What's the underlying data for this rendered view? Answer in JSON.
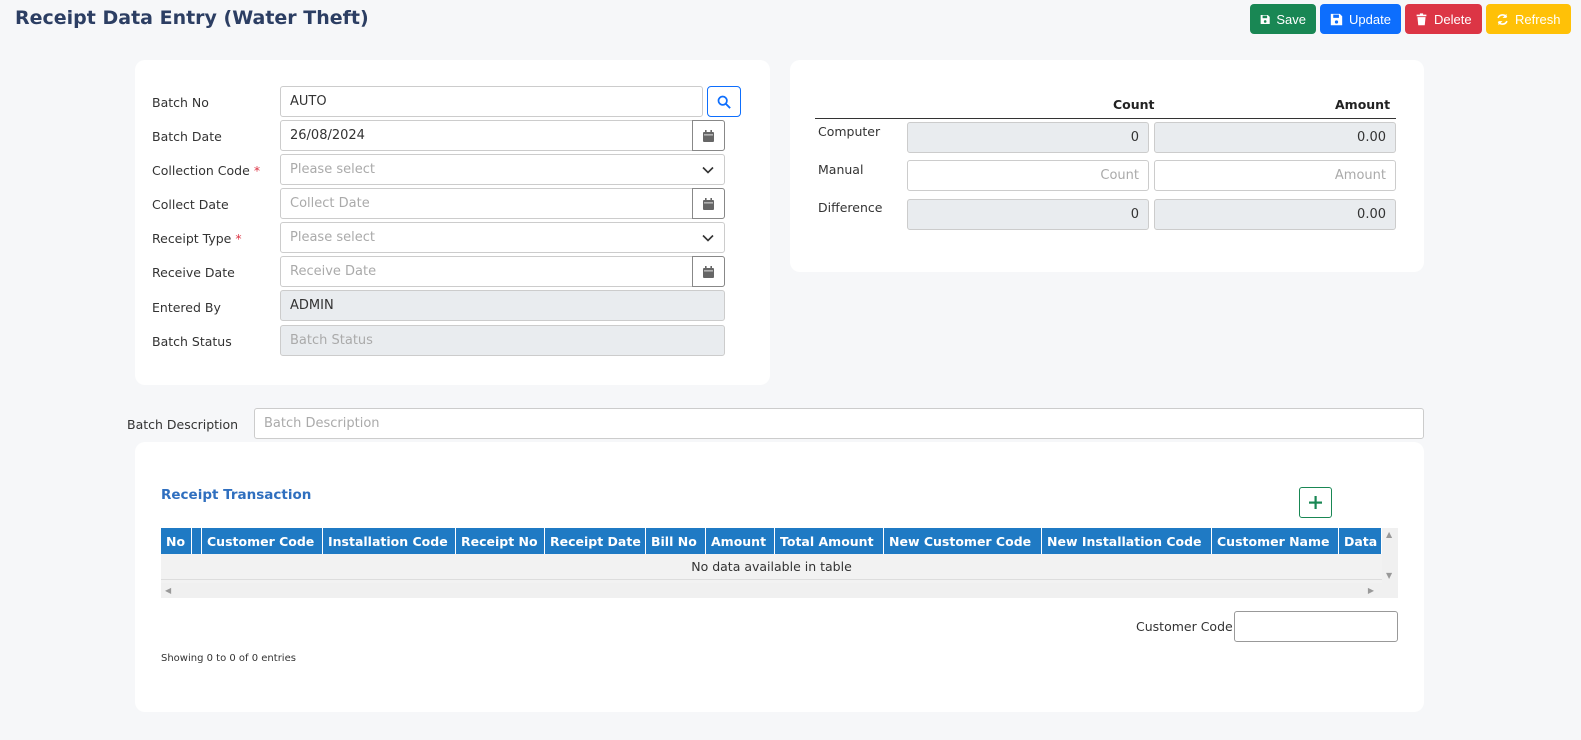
{
  "page": {
    "title": "Receipt Data Entry (Water Theft)"
  },
  "toolbar": {
    "save": "Save",
    "update": "Update",
    "delete": "Delete",
    "refresh": "Refresh"
  },
  "form": {
    "batch_no": {
      "label": "Batch No",
      "value": "AUTO"
    },
    "batch_date": {
      "label": "Batch Date",
      "value": "26/08/2024"
    },
    "collection_code": {
      "label": "Collection Code",
      "required_mark": "*",
      "placeholder": "Please select"
    },
    "collect_date": {
      "label": "Collect Date",
      "placeholder": "Collect Date"
    },
    "receipt_type": {
      "label": "Receipt Type",
      "required_mark": "*",
      "placeholder": "Please select"
    },
    "receive_date": {
      "label": "Receive Date",
      "placeholder": "Receive Date"
    },
    "entered_by": {
      "label": "Entered By",
      "value": "ADMIN"
    },
    "batch_status": {
      "label": "Batch Status",
      "placeholder": "Batch Status"
    }
  },
  "summary": {
    "count_header": "Count",
    "amount_header": "Amount",
    "computer": {
      "label": "Computer",
      "count": "0",
      "amount": "0.00"
    },
    "manual": {
      "label": "Manual",
      "count_placeholder": "Count",
      "amount_placeholder": "Amount"
    },
    "difference": {
      "label": "Difference",
      "count": "0",
      "amount": "0.00"
    }
  },
  "batch_description": {
    "label": "Batch Description",
    "placeholder": "Batch Description"
  },
  "transactions": {
    "title": "Receipt Transaction",
    "columns": [
      "No",
      "",
      "Customer Code",
      "Installation Code",
      "Receipt No",
      "Receipt Date",
      "Bill No",
      "Amount",
      "Total Amount",
      "New Customer Code",
      "New Installation Code",
      "Customer Name",
      "Data"
    ],
    "empty_message": "No data available in table",
    "filter_label": "Customer Code:",
    "info": "Showing 0 to 0 of 0 entries"
  },
  "colors": {
    "save": "#198754",
    "update": "#0d6efd",
    "delete": "#dc3545",
    "refresh": "#ffc107",
    "table_header": "#1f7ac4",
    "title": "#2c3e63"
  }
}
